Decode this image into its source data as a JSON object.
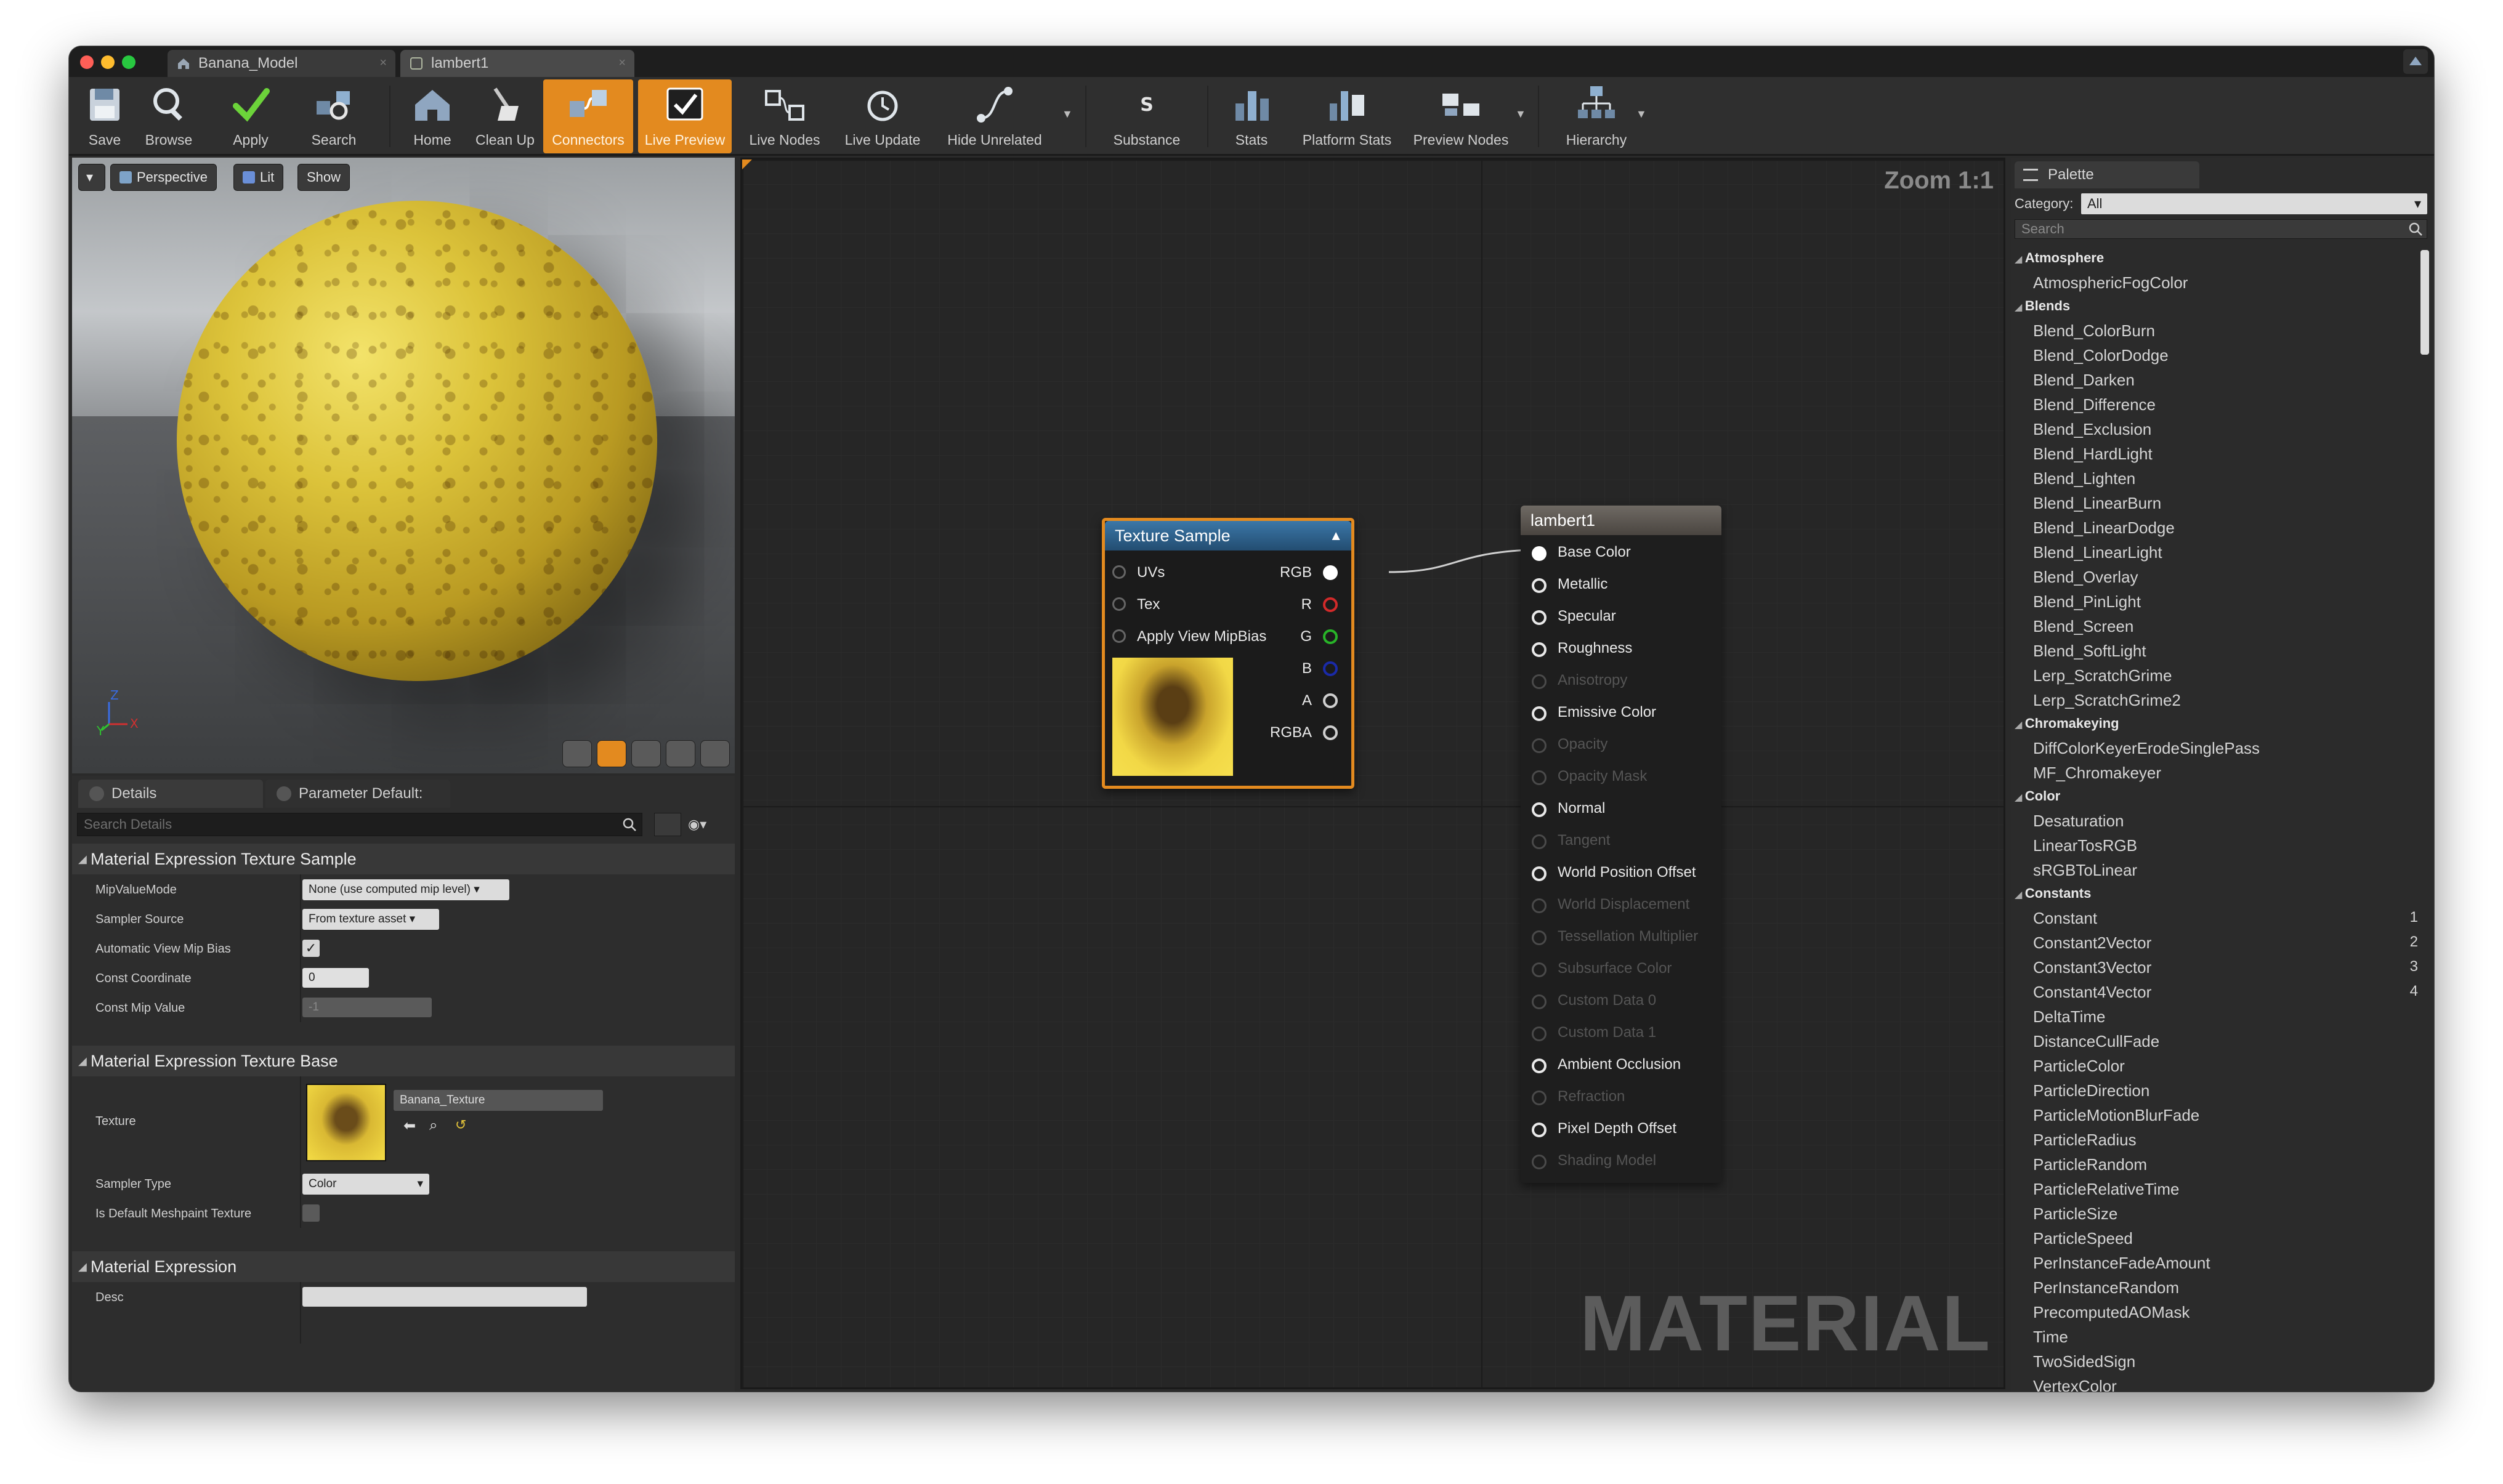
{
  "tabs": [
    {
      "label": "Banana_Model"
    },
    {
      "label": "lambert1"
    }
  ],
  "toolbar": {
    "buttons": [
      {
        "label": "Save"
      },
      {
        "label": "Browse"
      },
      {
        "label": "Apply"
      },
      {
        "label": "Search"
      },
      {
        "label": "Home"
      },
      {
        "label": "Clean Up"
      },
      {
        "label": "Connectors"
      },
      {
        "label": "Live Preview"
      },
      {
        "label": "Live Nodes"
      },
      {
        "label": "Live Update"
      },
      {
        "label": "Hide Unrelated"
      },
      {
        "label": "Substance"
      },
      {
        "label": "Stats"
      },
      {
        "label": "Platform Stats"
      },
      {
        "label": "Preview Nodes"
      },
      {
        "label": "Hierarchy"
      }
    ]
  },
  "viewport": {
    "perspective": "Perspective",
    "lit": "Lit",
    "show": "Show",
    "axes": {
      "z": "Z",
      "y": "Y",
      "x": "X"
    }
  },
  "details": {
    "tab1": "Details",
    "tab2": "Parameter Default:",
    "search_placeholder": "Search Details",
    "sec1": "Material Expression Texture Sample",
    "rows1": [
      {
        "label": "MipValueMode",
        "value": "None (use computed mip level)"
      },
      {
        "label": "Sampler Source",
        "value": "From texture asset"
      },
      {
        "label": "Automatic View Mip Bias",
        "value": "✓"
      },
      {
        "label": "Const Coordinate",
        "value": "0"
      },
      {
        "label": "Const Mip Value",
        "value": "-1"
      }
    ],
    "sec2": "Material Expression Texture Base",
    "texture_label": "Texture",
    "texture_value": "Banana_Texture",
    "sampler_type_label": "Sampler Type",
    "sampler_type_value": "Color",
    "meshpaint_label": "Is Default Meshpaint Texture",
    "sec3": "Material Expression",
    "desc_label": "Desc"
  },
  "graph": {
    "zoom": "Zoom 1:1",
    "watermark": "MATERIAL",
    "texture_node": {
      "title": "Texture Sample",
      "inputs": [
        "UVs",
        "Tex",
        "Apply View MipBias"
      ],
      "outputs": [
        "RGB",
        "R",
        "G",
        "B",
        "A",
        "RGBA"
      ]
    },
    "lambert_node": {
      "title": "lambert1",
      "pins": [
        {
          "label": "Base Color",
          "active": true
        },
        {
          "label": "Metallic",
          "active": true
        },
        {
          "label": "Specular",
          "active": true
        },
        {
          "label": "Roughness",
          "active": true
        },
        {
          "label": "Anisotropy",
          "active": false
        },
        {
          "label": "Emissive Color",
          "active": true
        },
        {
          "label": "Opacity",
          "active": false
        },
        {
          "label": "Opacity Mask",
          "active": false
        },
        {
          "label": "Normal",
          "active": true
        },
        {
          "label": "Tangent",
          "active": false
        },
        {
          "label": "World Position Offset",
          "active": true
        },
        {
          "label": "World Displacement",
          "active": false
        },
        {
          "label": "Tessellation Multiplier",
          "active": false
        },
        {
          "label": "Subsurface Color",
          "active": false
        },
        {
          "label": "Custom Data 0",
          "active": false
        },
        {
          "label": "Custom Data 1",
          "active": false
        },
        {
          "label": "Ambient Occlusion",
          "active": true
        },
        {
          "label": "Refraction",
          "active": false
        },
        {
          "label": "Pixel Depth Offset",
          "active": true
        },
        {
          "label": "Shading Model",
          "active": false
        }
      ]
    }
  },
  "palette": {
    "tab": "Palette",
    "category_label": "Category:",
    "category_value": "All",
    "search_placeholder": "Search",
    "categories": [
      {
        "name": "Atmosphere",
        "items": [
          {
            "label": "AtmosphericFogColor"
          }
        ]
      },
      {
        "name": "Blends",
        "items": [
          {
            "label": "Blend_ColorBurn"
          },
          {
            "label": "Blend_ColorDodge"
          },
          {
            "label": "Blend_Darken"
          },
          {
            "label": "Blend_Difference"
          },
          {
            "label": "Blend_Exclusion"
          },
          {
            "label": "Blend_HardLight"
          },
          {
            "label": "Blend_Lighten"
          },
          {
            "label": "Blend_LinearBurn"
          },
          {
            "label": "Blend_LinearDodge"
          },
          {
            "label": "Blend_LinearLight"
          },
          {
            "label": "Blend_Overlay"
          },
          {
            "label": "Blend_PinLight"
          },
          {
            "label": "Blend_Screen"
          },
          {
            "label": "Blend_SoftLight"
          },
          {
            "label": "Lerp_ScratchGrime"
          },
          {
            "label": "Lerp_ScratchGrime2"
          }
        ]
      },
      {
        "name": "Chromakeying",
        "items": [
          {
            "label": "DiffColorKeyerErodeSinglePass"
          },
          {
            "label": "MF_Chromakeyer"
          }
        ]
      },
      {
        "name": "Color",
        "items": [
          {
            "label": "Desaturation"
          },
          {
            "label": "LinearTosRGB"
          },
          {
            "label": "sRGBToLinear"
          }
        ]
      },
      {
        "name": "Constants",
        "items": [
          {
            "label": "Constant",
            "num": "1"
          },
          {
            "label": "Constant2Vector",
            "num": "2"
          },
          {
            "label": "Constant3Vector",
            "num": "3"
          },
          {
            "label": "Constant4Vector",
            "num": "4"
          },
          {
            "label": "DeltaTime"
          },
          {
            "label": "DistanceCullFade"
          },
          {
            "label": "ParticleColor"
          },
          {
            "label": "ParticleDirection"
          },
          {
            "label": "ParticleMotionBlurFade"
          },
          {
            "label": "ParticleRadius"
          },
          {
            "label": "ParticleRandom"
          },
          {
            "label": "ParticleRelativeTime"
          },
          {
            "label": "ParticleSize"
          },
          {
            "label": "ParticleSpeed"
          },
          {
            "label": "PerInstanceFadeAmount"
          },
          {
            "label": "PerInstanceRandom"
          },
          {
            "label": "PrecomputedAOMask"
          },
          {
            "label": "Time"
          },
          {
            "label": "TwoSidedSign"
          },
          {
            "label": "VertexColor"
          }
        ]
      }
    ]
  },
  "colors": {
    "accent": "#e38a1f",
    "node_header_blue": "#2d5d86",
    "node_header_grey": "#5a5550",
    "pin_red": "#d22a2a",
    "pin_green": "#28b428",
    "pin_blue": "#1a2aa8"
  }
}
